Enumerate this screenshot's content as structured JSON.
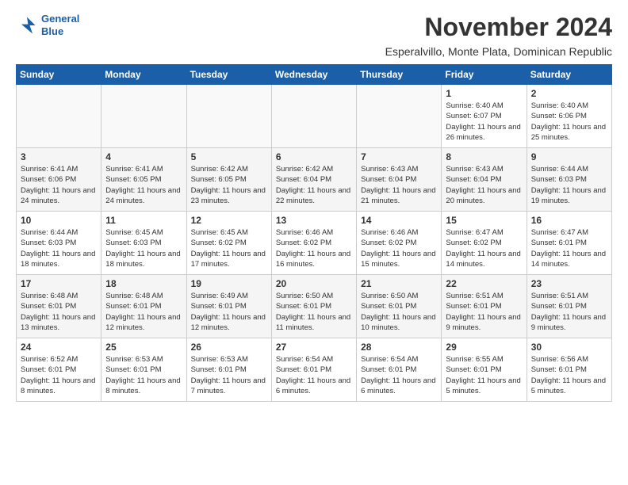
{
  "logo": {
    "line1": "General",
    "line2": "Blue"
  },
  "title": "November 2024",
  "subtitle": "Esperalvillo, Monte Plata, Dominican Republic",
  "days_of_week": [
    "Sunday",
    "Monday",
    "Tuesday",
    "Wednesday",
    "Thursday",
    "Friday",
    "Saturday"
  ],
  "weeks": [
    [
      {
        "day": "",
        "info": ""
      },
      {
        "day": "",
        "info": ""
      },
      {
        "day": "",
        "info": ""
      },
      {
        "day": "",
        "info": ""
      },
      {
        "day": "",
        "info": ""
      },
      {
        "day": "1",
        "info": "Sunrise: 6:40 AM\nSunset: 6:07 PM\nDaylight: 11 hours and 26 minutes."
      },
      {
        "day": "2",
        "info": "Sunrise: 6:40 AM\nSunset: 6:06 PM\nDaylight: 11 hours and 25 minutes."
      }
    ],
    [
      {
        "day": "3",
        "info": "Sunrise: 6:41 AM\nSunset: 6:06 PM\nDaylight: 11 hours and 24 minutes."
      },
      {
        "day": "4",
        "info": "Sunrise: 6:41 AM\nSunset: 6:05 PM\nDaylight: 11 hours and 24 minutes."
      },
      {
        "day": "5",
        "info": "Sunrise: 6:42 AM\nSunset: 6:05 PM\nDaylight: 11 hours and 23 minutes."
      },
      {
        "day": "6",
        "info": "Sunrise: 6:42 AM\nSunset: 6:04 PM\nDaylight: 11 hours and 22 minutes."
      },
      {
        "day": "7",
        "info": "Sunrise: 6:43 AM\nSunset: 6:04 PM\nDaylight: 11 hours and 21 minutes."
      },
      {
        "day": "8",
        "info": "Sunrise: 6:43 AM\nSunset: 6:04 PM\nDaylight: 11 hours and 20 minutes."
      },
      {
        "day": "9",
        "info": "Sunrise: 6:44 AM\nSunset: 6:03 PM\nDaylight: 11 hours and 19 minutes."
      }
    ],
    [
      {
        "day": "10",
        "info": "Sunrise: 6:44 AM\nSunset: 6:03 PM\nDaylight: 11 hours and 18 minutes."
      },
      {
        "day": "11",
        "info": "Sunrise: 6:45 AM\nSunset: 6:03 PM\nDaylight: 11 hours and 18 minutes."
      },
      {
        "day": "12",
        "info": "Sunrise: 6:45 AM\nSunset: 6:02 PM\nDaylight: 11 hours and 17 minutes."
      },
      {
        "day": "13",
        "info": "Sunrise: 6:46 AM\nSunset: 6:02 PM\nDaylight: 11 hours and 16 minutes."
      },
      {
        "day": "14",
        "info": "Sunrise: 6:46 AM\nSunset: 6:02 PM\nDaylight: 11 hours and 15 minutes."
      },
      {
        "day": "15",
        "info": "Sunrise: 6:47 AM\nSunset: 6:02 PM\nDaylight: 11 hours and 14 minutes."
      },
      {
        "day": "16",
        "info": "Sunrise: 6:47 AM\nSunset: 6:01 PM\nDaylight: 11 hours and 14 minutes."
      }
    ],
    [
      {
        "day": "17",
        "info": "Sunrise: 6:48 AM\nSunset: 6:01 PM\nDaylight: 11 hours and 13 minutes."
      },
      {
        "day": "18",
        "info": "Sunrise: 6:48 AM\nSunset: 6:01 PM\nDaylight: 11 hours and 12 minutes."
      },
      {
        "day": "19",
        "info": "Sunrise: 6:49 AM\nSunset: 6:01 PM\nDaylight: 11 hours and 12 minutes."
      },
      {
        "day": "20",
        "info": "Sunrise: 6:50 AM\nSunset: 6:01 PM\nDaylight: 11 hours and 11 minutes."
      },
      {
        "day": "21",
        "info": "Sunrise: 6:50 AM\nSunset: 6:01 PM\nDaylight: 11 hours and 10 minutes."
      },
      {
        "day": "22",
        "info": "Sunrise: 6:51 AM\nSunset: 6:01 PM\nDaylight: 11 hours and 9 minutes."
      },
      {
        "day": "23",
        "info": "Sunrise: 6:51 AM\nSunset: 6:01 PM\nDaylight: 11 hours and 9 minutes."
      }
    ],
    [
      {
        "day": "24",
        "info": "Sunrise: 6:52 AM\nSunset: 6:01 PM\nDaylight: 11 hours and 8 minutes."
      },
      {
        "day": "25",
        "info": "Sunrise: 6:53 AM\nSunset: 6:01 PM\nDaylight: 11 hours and 8 minutes."
      },
      {
        "day": "26",
        "info": "Sunrise: 6:53 AM\nSunset: 6:01 PM\nDaylight: 11 hours and 7 minutes."
      },
      {
        "day": "27",
        "info": "Sunrise: 6:54 AM\nSunset: 6:01 PM\nDaylight: 11 hours and 6 minutes."
      },
      {
        "day": "28",
        "info": "Sunrise: 6:54 AM\nSunset: 6:01 PM\nDaylight: 11 hours and 6 minutes."
      },
      {
        "day": "29",
        "info": "Sunrise: 6:55 AM\nSunset: 6:01 PM\nDaylight: 11 hours and 5 minutes."
      },
      {
        "day": "30",
        "info": "Sunrise: 6:56 AM\nSunset: 6:01 PM\nDaylight: 11 hours and 5 minutes."
      }
    ]
  ]
}
